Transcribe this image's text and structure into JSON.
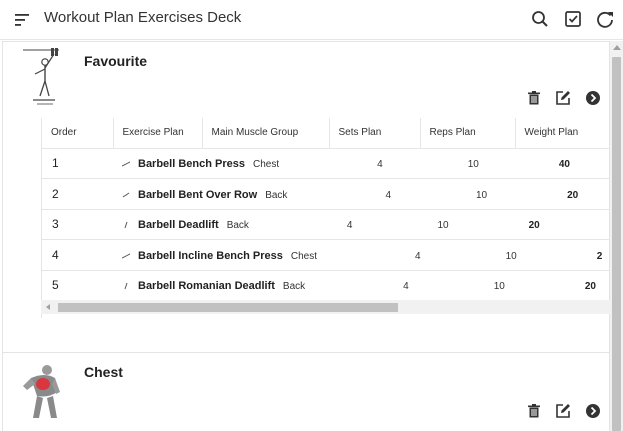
{
  "app": {
    "title": "Workout Plan Exercises Deck"
  },
  "toolbar": {
    "icons": [
      "menu-icon",
      "search-icon",
      "checkbox-icon",
      "refresh-icon"
    ]
  },
  "favourite": {
    "title": "Favourite",
    "columns": [
      "Order",
      "Exercise Plan",
      "Main Muscle Group",
      "Sets Plan",
      "Reps Plan",
      "Weight Plan"
    ],
    "rows": [
      {
        "order": "1",
        "exercise": "Barbell Bench Press",
        "muscle": "Chest",
        "sets": "4",
        "reps": "10",
        "weight": "40"
      },
      {
        "order": "2",
        "exercise": "Barbell Bent Over Row",
        "muscle": "Back",
        "sets": "4",
        "reps": "10",
        "weight": "20"
      },
      {
        "order": "3",
        "exercise": "Barbell Deadlift",
        "muscle": "Back",
        "sets": "4",
        "reps": "10",
        "weight": "20"
      },
      {
        "order": "4",
        "exercise": "Barbell Incline Bench Press",
        "muscle": "Chest",
        "sets": "4",
        "reps": "10",
        "weight": "2"
      },
      {
        "order": "5",
        "exercise": "Barbell Romanian Deadlift",
        "muscle": "Back",
        "sets": "4",
        "reps": "10",
        "weight": "20"
      }
    ]
  },
  "chest": {
    "title": "Chest"
  },
  "colors": {
    "icon": "#333333",
    "border": "#e6e6e6",
    "chest_highlight": "#d9363e"
  }
}
